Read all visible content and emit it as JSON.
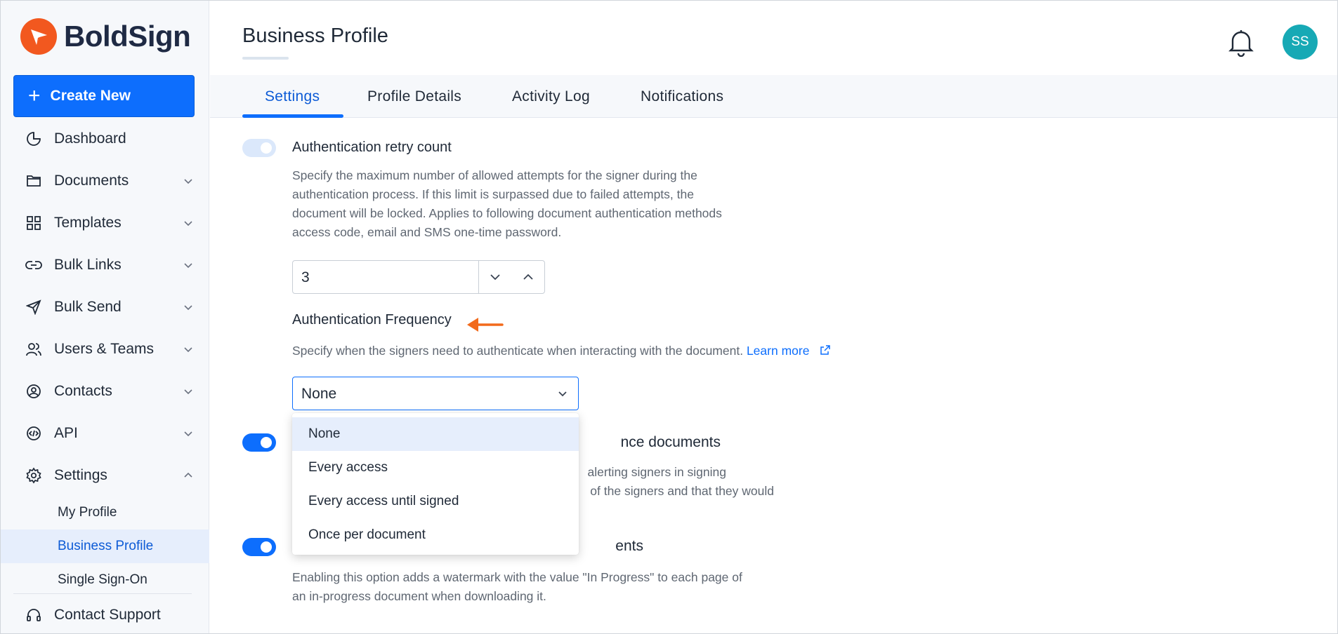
{
  "app": {
    "brand": "BoldSign",
    "accent": "#0d6efd",
    "logo_color": "#f2581f"
  },
  "sidebar": {
    "create_new": "Create New",
    "items": [
      {
        "label": "Dashboard",
        "icon": "pie-chart-icon"
      },
      {
        "label": "Documents",
        "icon": "folder-icon"
      },
      {
        "label": "Templates",
        "icon": "grid-icon"
      },
      {
        "label": "Bulk Links",
        "icon": "link-icon"
      },
      {
        "label": "Bulk Send",
        "icon": "send-icon"
      },
      {
        "label": "Users & Teams",
        "icon": "users-icon"
      },
      {
        "label": "Contacts",
        "icon": "contact-icon"
      },
      {
        "label": "API",
        "icon": "api-icon"
      },
      {
        "label": "Settings",
        "icon": "gear-icon"
      }
    ],
    "settings_sub": [
      "My Profile",
      "Business Profile",
      "Single Sign-On"
    ],
    "active_sub": "Business Profile",
    "contact_support": "Contact Support"
  },
  "header": {
    "title": "Business Profile",
    "avatar_initials": "SS"
  },
  "tabs": [
    "Settings",
    "Profile Details",
    "Activity Log",
    "Notifications"
  ],
  "active_tab": "Settings",
  "settings": {
    "retry": {
      "title": "Authentication retry count",
      "desc_lines": [
        "Specify the maximum number of allowed attempts for the signer during the",
        "authentication process. If this limit is surpassed due to failed attempts, the",
        "document will be locked. Applies to following document authentication methods",
        "access code, email and SMS one-time password."
      ],
      "value": "3"
    },
    "frequency": {
      "title": "Authentication Frequency",
      "desc": "Specify when the signers need to authenticate when interacting with the document.",
      "learn_more": "Learn more",
      "selected": "None",
      "options": [
        "None",
        "Every access",
        "Every access until signed",
        "Once per document"
      ]
    },
    "setting3": {
      "title_partial": "nce documents",
      "desc_partial_lines": [
        "alerting signers in signing",
        "of the signers and that they would"
      ]
    },
    "watermark": {
      "title_partial": "ents",
      "desc_lines": [
        "Enabling this option adds a watermark with the value \"In Progress\" to each page of",
        "an in-progress document when downloading it."
      ]
    }
  }
}
